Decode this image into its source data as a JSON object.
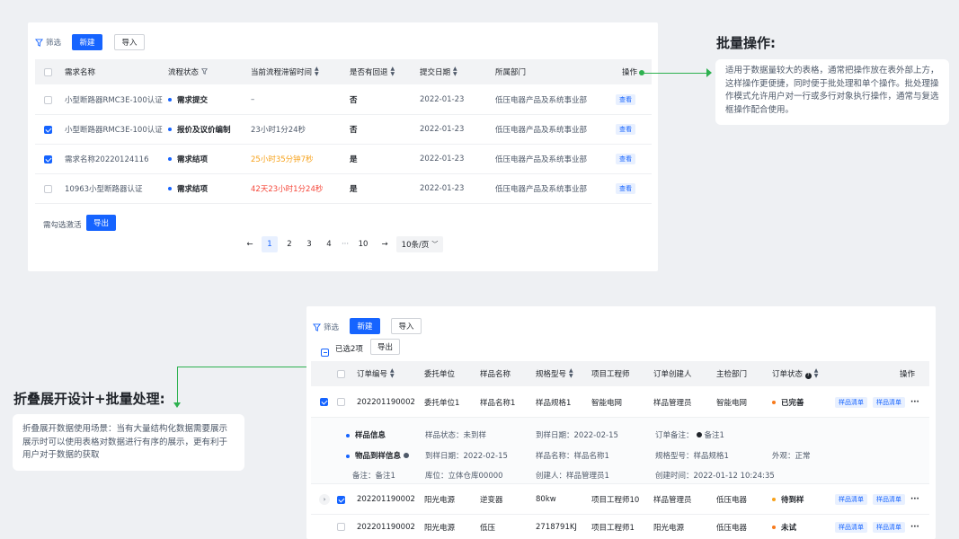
{
  "top": {
    "filter_label": "筛选",
    "new_label": "新建",
    "import_label": "导入",
    "columns": {
      "name": "需求名称",
      "status": "流程状态",
      "duration": "当前流程滞留时间",
      "returned": "是否有回退",
      "submit_date": "提交日期",
      "dept": "所属部门",
      "action": "操作"
    },
    "rows": [
      {
        "checked": false,
        "name": "小型断路器RMC3E-100认证",
        "status": "需求提交",
        "duration": "–",
        "duration_color": "#4e5969",
        "returned": "否",
        "date": "2022-01-23",
        "dept": "低压电器产品及系统事业部",
        "action": "查看"
      },
      {
        "checked": true,
        "name": "小型断路器RMC3E-100认证",
        "status": "报价及议价编制",
        "duration": "23小时1分24秒",
        "duration_color": "#4e5969",
        "returned": "否",
        "date": "2022-01-23",
        "dept": "低压电器产品及系统事业部",
        "action": "查看"
      },
      {
        "checked": true,
        "name": "需求名称20220124116",
        "status": "需求结项",
        "duration": "25小时35分钟7秒",
        "duration_color": "#f7a21b",
        "returned": "是",
        "date": "2022-01-23",
        "dept": "低压电器产品及系统事业部",
        "action": "查看"
      },
      {
        "checked": false,
        "name": "10963小型断路器认证",
        "status": "需求结项",
        "duration": "42天23小时1分24秒",
        "duration_color": "#f5483b",
        "returned": "是",
        "date": "2022-01-23",
        "dept": "低压电器产品及系统事业部",
        "action": "查看"
      }
    ],
    "batch_hint": "需勾选激活",
    "export_label": "导出",
    "pagination": {
      "prev": "←",
      "pages": [
        "1",
        "2",
        "3",
        "4"
      ],
      "ellipsis": "···",
      "last": "10",
      "next": "→",
      "page_size": "10条/页",
      "current": "1"
    }
  },
  "note1": {
    "title": "批量操作:",
    "body": "适用于数据量较大的表格，通常把操作放在表外部上方，这样操作更便捷，同时便于批处理和单个操作。批处理操作模式允许用户对一行或多行对象执行操作，通常与复选框操作配合使用。"
  },
  "note2": {
    "title": "折叠展开设计+批量处理:",
    "body": "折叠展开数据使用场景：当有大量结构化数据需要展示展示时可以使用表格对数据进行有序的展示，更有利于用户对于数据的获取"
  },
  "bottom": {
    "filter_label": "筛选",
    "new_label": "新建",
    "import_label": "导入",
    "selected_label": "已选2项",
    "export_label": "导出",
    "columns": {
      "order_no": "订单编号",
      "client": "委托单位",
      "sample": "样品名称",
      "spec": "规格型号",
      "engineer": "项目工程师",
      "creator": "订单创建人",
      "dept": "主检部门",
      "status": "订单状态",
      "action": "操作"
    },
    "rows": [
      {
        "order_no": "202201190002",
        "client": "委托单位1",
        "sample": "样品名称1",
        "spec": "样品规格1",
        "engineer": "智能电网",
        "creator": "样品管理员",
        "dept": "智能电网",
        "status": "已完善",
        "status_color": "#f77a1b",
        "tag1": "样品清单",
        "tag2": "样品清单",
        "more": "···"
      },
      {
        "order_no": "202201190002",
        "client": "阳光电源",
        "sample": "逆变器",
        "spec": "80kw",
        "engineer": "项目工程师10",
        "creator": "样品管理员",
        "dept": "低压电器",
        "status": "待到样",
        "status_color": "#f7a21b",
        "tag1": "样品清单",
        "tag2": "样品清单",
        "more": "···"
      },
      {
        "order_no": "202201190002",
        "client": "阳光电源",
        "sample": "低压",
        "spec": "2718791KJ",
        "engineer": "项目工程师1",
        "creator": "阳光电源",
        "dept": "低压电器",
        "status": "未试",
        "status_color": "#f77a1b",
        "tag1": "样品清单",
        "tag2": "样品清单",
        "more": "···"
      }
    ],
    "detail": {
      "sample_info": "样品信息",
      "sample_status": "样品状态：未到样",
      "arrival_date": "到样日期：2022-02-15",
      "order_note": "订单备注：",
      "order_note_val": "备注1",
      "arrival_info": "物品到样信息",
      "arrival_date2": "到样日期：2022-02-15",
      "sample_name": "样品名称：样品名称1",
      "spec": "规格型号：样品规格1",
      "appearance": "外观：正常",
      "remark": "备注：备注1",
      "location": "库位：立体仓库00000",
      "creator": "创建人：样品管理员1",
      "created_at": "创建时间：2022-01-12 10:24:35"
    }
  },
  "colors": {
    "primary": "#1664ff",
    "accent_line": "#2db14f",
    "orange": "#f7a21b",
    "red": "#f5483b"
  }
}
